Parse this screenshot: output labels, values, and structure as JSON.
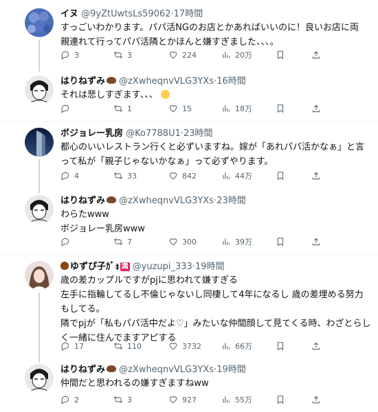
{
  "posts": [
    {
      "name": "イヌ",
      "handle": "@9yZtUwtsLs59062",
      "time": "17時間",
      "lines": [
        "すっごいわかります。パパ活NGのお店とかあればいいのに！良いお店に両",
        "親連れて行ってパパ活隣とかほんと嫌すぎました、、、。"
      ],
      "replies": "3",
      "reposts": "3",
      "likes": "224",
      "views": "20万",
      "avatar_icon": "hydrangea-avatar"
    },
    {
      "name": "はりねずみ",
      "handle": "@zXwheqnvVLG3YXs",
      "time": "16時間",
      "lines": [
        "それは悲しすぎます、、、"
      ],
      "replies": "",
      "reposts": "1",
      "likes": "15",
      "views": "18万",
      "avatar_icon": "manga-character-avatar"
    },
    {
      "name": "ボジョレー乳房",
      "handle": "@Ko7788U1",
      "time": "23時間",
      "lines": [
        "都心のいいレストラン行くと必ずいますね。嫁が「あれパパ活かなぁ」と言",
        "って私が「親子じゃないかなぁ」って必ずやります。"
      ],
      "replies": "4",
      "reposts": "33",
      "likes": "842",
      "views": "44万",
      "avatar_icon": "skyscraper-avatar"
    },
    {
      "name": "はりねずみ",
      "handle": "@zXwheqnvVLG3YXs",
      "time": "23時間",
      "lines": [
        "わらたwww",
        "ボジョレー乳房www"
      ],
      "replies": "",
      "reposts": "7",
      "likes": "300",
      "views": "39万",
      "avatar_icon": "manga-character-avatar"
    },
    {
      "name": "ゆずぴ子ｶﾞ",
      "badge": "満",
      "handle": "@yuzupi_333",
      "time": "19時間",
      "lines": [
        "歳の差カップルですがpjに思われて嫌すぎる",
        "左手に指輪してるし不倫じゃないし同棲して4年になるし 歳の差埋める努力",
        "もしてる。",
        "隣でpjが「私もパパ活中だよ♡」みたいな仲間顔して見てくる時、わざとらし",
        "く一緒に住んでますアピする"
      ],
      "replies": "17",
      "reposts": "110",
      "likes": "3732",
      "views": "66万",
      "avatar_icon": "woman-photo-avatar"
    },
    {
      "name": "はりねずみ",
      "handle": "@zXwheqnvVLG3YXs",
      "time": "19時間",
      "lines": [
        "仲間だと思われるの嫌すぎますねww"
      ],
      "replies": "2",
      "reposts": "3",
      "likes": "927",
      "views": "55万",
      "avatar_icon": "manga-character-avatar"
    }
  ],
  "colors": {
    "text": "#0f1419",
    "muted": "#536471",
    "divider": "#eff3f4"
  }
}
